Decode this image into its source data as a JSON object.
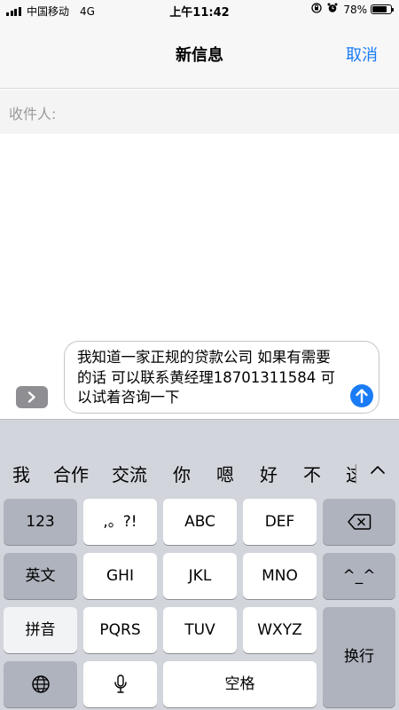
{
  "status_bar": {
    "carrier": "中国移动",
    "network": "4G",
    "time": "上午11:42",
    "lock_icon": "orientation-lock-icon",
    "alarm_icon": "alarm-icon",
    "battery_text": "78%",
    "battery_level": 0.78
  },
  "nav": {
    "title": "新信息",
    "cancel_label": "取消"
  },
  "recipient": {
    "label": "收件人:",
    "value": ""
  },
  "compose": {
    "expand_icon": "chevron-right-icon",
    "message": "我知道一家正规的贷款公司 如果有需要的话 可以联系黄经理18701311584 可以试着咨询一下",
    "send_icon": "arrow-up-icon"
  },
  "keyboard": {
    "suggestions": [
      "我",
      "合作",
      "交流",
      "你",
      "嗯",
      "好",
      "不",
      "这"
    ],
    "collapse_icon": "chevron-up-icon",
    "keys": {
      "numbers": "123",
      "punct": ",。?!",
      "abc": "ABC",
      "def": "DEF",
      "backspace_icon": "backspace-icon",
      "english": "英文",
      "ghi": "GHI",
      "jkl": "JKL",
      "mno": "MNO",
      "emoji": "^_^",
      "pinyin": "拼音",
      "pqrs": "PQRS",
      "tuv": "TUV",
      "wxyz": "WXYZ",
      "enter": "换行",
      "globe_icon": "globe-icon",
      "mic_icon": "microphone-icon",
      "space": "空格"
    }
  },
  "colors": {
    "accent": "#1a7cf5",
    "keyboard_bg": "#d2d5db",
    "dark_key": "#aeb3bd"
  }
}
